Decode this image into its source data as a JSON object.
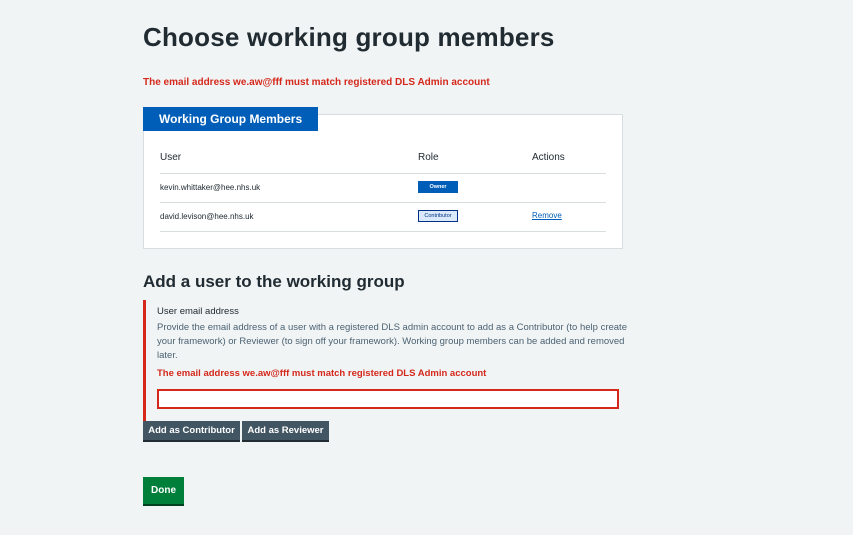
{
  "page": {
    "title": "Choose working group members",
    "error_summary": "The email address we.aw@fff must match registered DLS Admin account"
  },
  "members_panel": {
    "label": "Working Group Members",
    "headers": {
      "user": "User",
      "role": "Role",
      "actions": "Actions"
    },
    "rows": [
      {
        "user": "kevin.whittaker@hee.nhs.uk",
        "role": "Owner",
        "action": ""
      },
      {
        "user": "david.levison@hee.nhs.uk",
        "role": "Contributor",
        "action": "Remove"
      }
    ]
  },
  "add_user": {
    "heading": "Add a user to the working group",
    "field_label": "User email address",
    "hint": "Provide the email address of a user with a registered DLS admin account to add as a Contributor (to help create your framework) or Reviewer (to sign off your framework). Working group members can be added and removed later.",
    "error": "The email address we.aw@fff must match registered DLS Admin account",
    "email_value": "",
    "add_contributor_label": "Add as Contributor",
    "add_reviewer_label": "Add as Reviewer"
  },
  "done_label": "Done",
  "colors": {
    "background": "#f0f4f5",
    "brand_blue": "#005eb8",
    "error_red": "#d5281b",
    "secondary_button": "#425563",
    "done_green": "#007f3b"
  }
}
